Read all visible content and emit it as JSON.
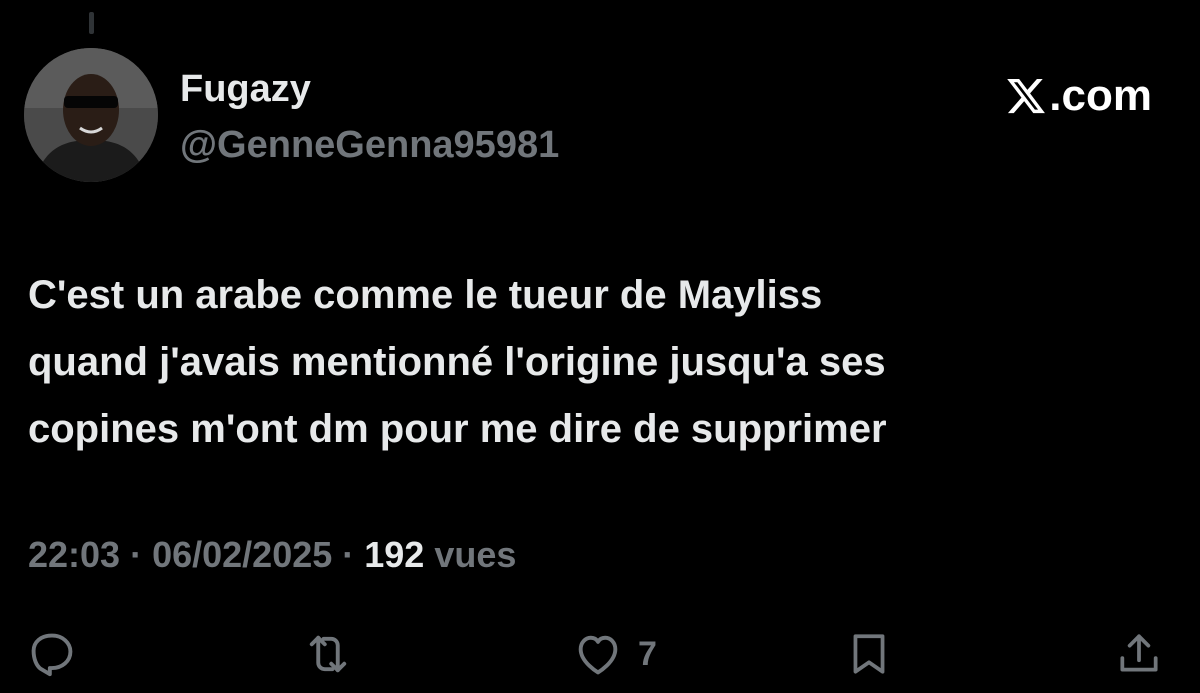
{
  "author": {
    "display_name": "Fugazy",
    "handle": "@GenneGenna95981",
    "avatar_icon": "user-avatar"
  },
  "brand": {
    "text": ".com",
    "logo_icon": "x-logo-icon"
  },
  "tweet": {
    "lines": [
      "C'est un arabe comme le tueur de Mayliss",
      "quand j'avais mentionné l'origine jusqu'a ses",
      "copines m'ont dm pour me dire de supprimer"
    ]
  },
  "meta": {
    "time": "22:03",
    "separator": " · ",
    "date": "06/02/2025",
    "views_count": "192",
    "views_label": " vues"
  },
  "actions": {
    "reply_icon": "reply-icon",
    "repost_icon": "repost-icon",
    "like_icon": "heart-icon",
    "like_count": "7",
    "bookmark_icon": "bookmark-icon",
    "share_icon": "share-icon"
  },
  "colors": {
    "background": "#000000",
    "primary_text": "#e7e9ea",
    "secondary_text": "#71767b"
  }
}
